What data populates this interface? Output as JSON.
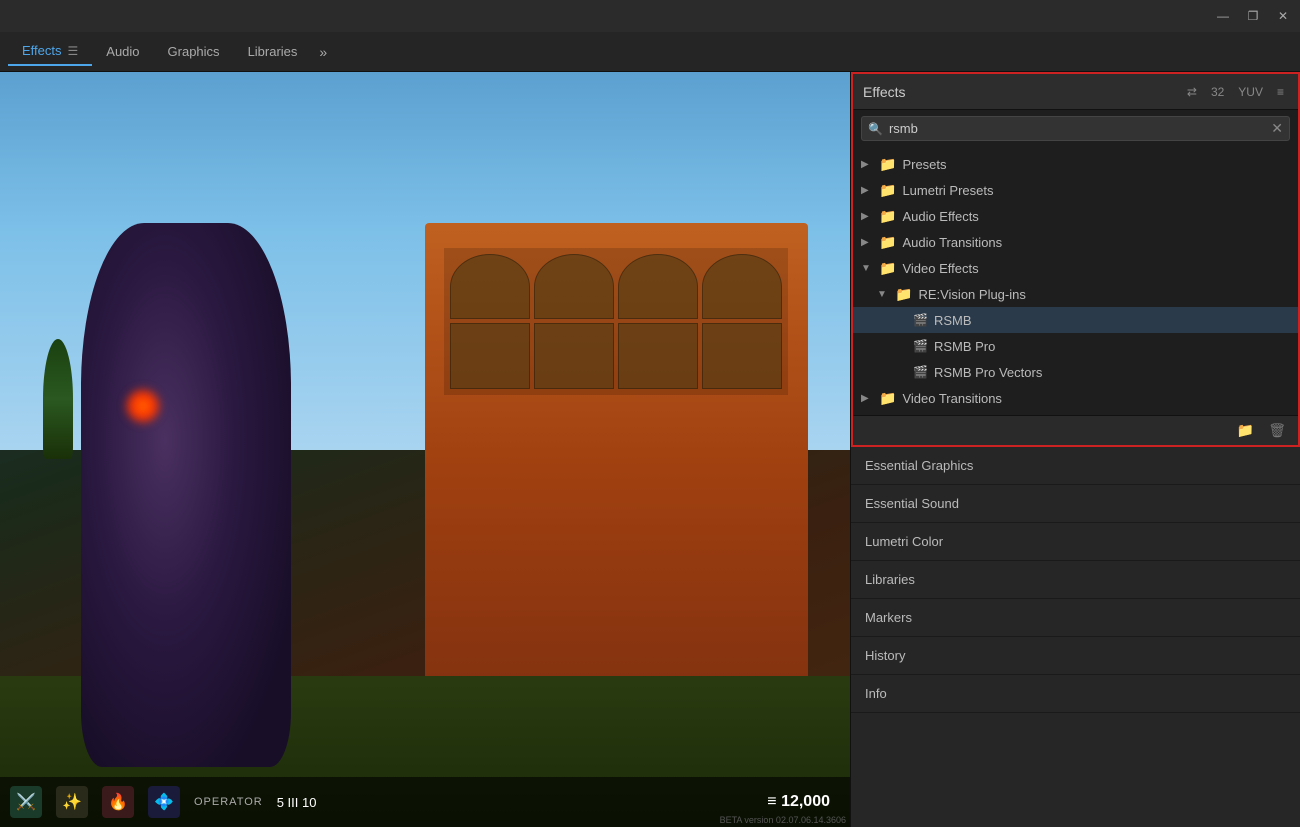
{
  "titlebar": {
    "minimize": "—",
    "maximize": "❐",
    "close": "✕"
  },
  "tabbar": {
    "tabs": [
      {
        "label": "Effects",
        "active": true
      },
      {
        "label": "Audio",
        "active": false
      },
      {
        "label": "Graphics",
        "active": false
      },
      {
        "label": "Libraries",
        "active": false
      }
    ],
    "more_label": "»"
  },
  "effects_panel": {
    "title": "Effects",
    "menu_icon": "≡",
    "search_value": "rsmb",
    "search_placeholder": "Search",
    "filter_icons": [
      {
        "label": "⇄",
        "title": "Accelerated Effects"
      },
      {
        "label": "32",
        "title": "32-bit"
      },
      {
        "label": "YUV",
        "title": "YUV"
      }
    ],
    "tree": [
      {
        "id": "presets",
        "label": "Presets",
        "level": 0,
        "type": "folder",
        "expanded": false
      },
      {
        "id": "lumetri",
        "label": "Lumetri Presets",
        "level": 0,
        "type": "folder",
        "expanded": false
      },
      {
        "id": "audio-effects",
        "label": "Audio Effects",
        "level": 0,
        "type": "folder",
        "expanded": false
      },
      {
        "id": "audio-transitions",
        "label": "Audio Transitions",
        "level": 0,
        "type": "folder",
        "expanded": false
      },
      {
        "id": "video-effects",
        "label": "Video Effects",
        "level": 0,
        "type": "folder",
        "expanded": true
      },
      {
        "id": "revision-plugins",
        "label": "RE:Vision Plug-ins",
        "level": 1,
        "type": "folder",
        "expanded": true
      },
      {
        "id": "rsmb",
        "label": "RSMB",
        "level": 2,
        "type": "effect",
        "selected": true
      },
      {
        "id": "rsmb-pro",
        "label": "RSMB Pro",
        "level": 2,
        "type": "effect"
      },
      {
        "id": "rsmb-pro-vectors",
        "label": "RSMB Pro Vectors",
        "level": 2,
        "type": "effect"
      },
      {
        "id": "video-transitions",
        "label": "Video Transitions",
        "level": 0,
        "type": "folder",
        "expanded": false
      }
    ],
    "footer_new_folder": "📁",
    "footer_delete": "🗑"
  },
  "bottom_panels": [
    {
      "label": "Essential Graphics"
    },
    {
      "label": "Essential Sound"
    },
    {
      "label": "Lumetri Color"
    },
    {
      "label": "Libraries"
    },
    {
      "label": "Markers"
    },
    {
      "label": "History"
    },
    {
      "label": "Info"
    }
  ],
  "hud": {
    "operator": "OPERATOR",
    "score": "≡ 12,000",
    "version": "BETA version 02.07.06.14.3606",
    "ammo_current": "5",
    "ammo_total": "10"
  }
}
